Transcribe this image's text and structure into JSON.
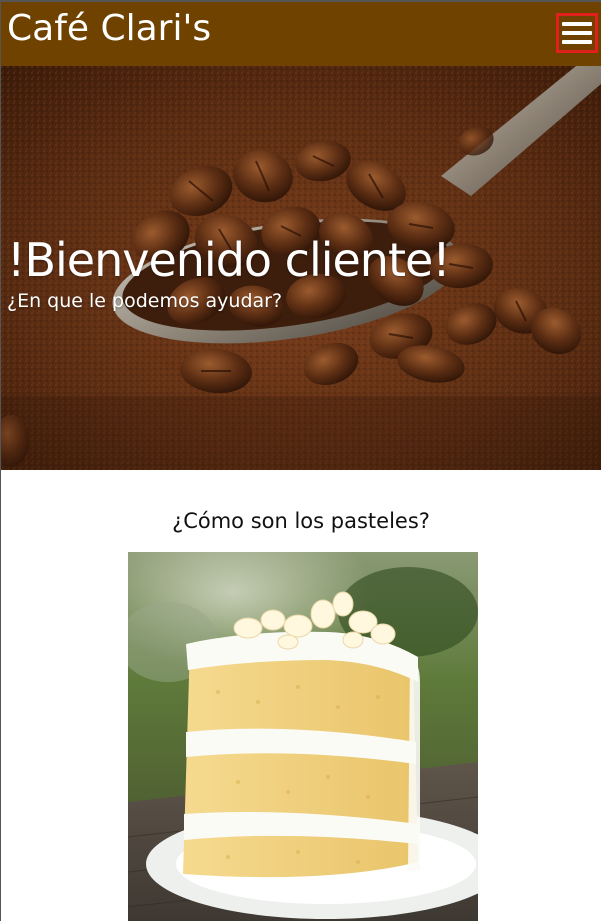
{
  "header": {
    "brand": "Café Clari's",
    "menu_icon": "hamburger-menu-icon",
    "background_color": "#6f4200",
    "menu_highlight_color": "#e0201b"
  },
  "hero": {
    "image": "coffee-beans-spoon-photo",
    "title": "!Bienvenido cliente!",
    "subtitle": "¿En que le podemos ayudar?"
  },
  "section": {
    "title": "¿Cómo son los pasteles?",
    "image": "layer-cake-slice-photo"
  }
}
